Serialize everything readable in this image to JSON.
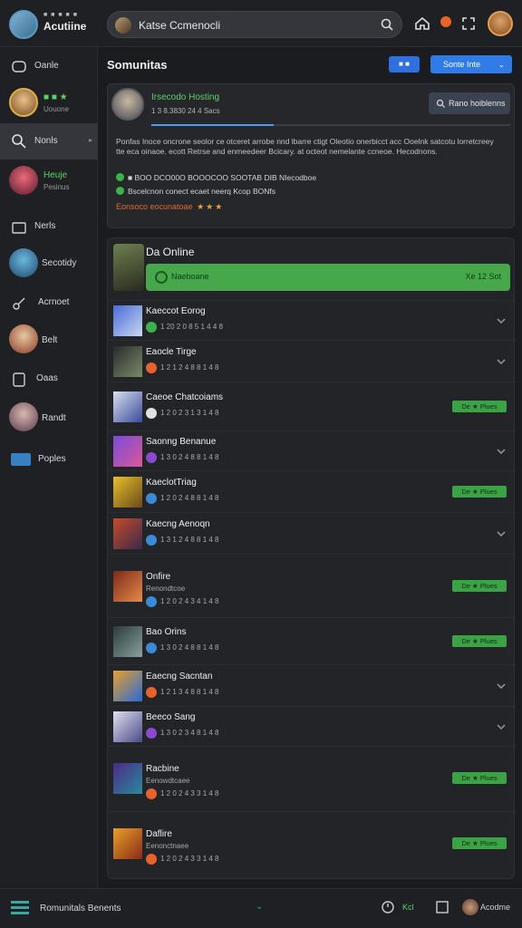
{
  "app": {
    "badge": "■ ■ ■ ■ ■",
    "title": "Acutiine",
    "search_text": "Katse Ccmenocli"
  },
  "sidebar": {
    "items": [
      {
        "label": "Oanle",
        "sub": ""
      },
      {
        "label": "",
        "sub": "Uouone"
      },
      {
        "label": "Nonls",
        "sub": ""
      },
      {
        "label": "Heuje",
        "sub": "Pesinus"
      },
      {
        "label": "Nerls",
        "sub": ""
      },
      {
        "label": "Secotidy",
        "sub": ""
      },
      {
        "label": "Acrnoet",
        "sub": ""
      },
      {
        "label": "Belt",
        "sub": ""
      },
      {
        "label": "Oaas",
        "sub": ""
      },
      {
        "label": "Randt",
        "sub": ""
      },
      {
        "label": "Poples",
        "sub": ""
      }
    ]
  },
  "header": {
    "title": "Somunitas",
    "small_button": "■ ■",
    "primary_button": "Sonte Inte"
  },
  "card": {
    "title": "Irsecodo Hosting",
    "meta": "1 3 8.3830 24 4 Sacs",
    "progress": 0.34,
    "button": "Rano hoiblenns",
    "description": "Ponfas Inoce oncrone seolor ce otceret arrobe nnd lbarre ctigt Oleotio onerbicct acc Ooelnk satcotu lorretcreey tte eca oinaoe. ecott Retrse and enmeedeer Bcicary. at octeot nemelante ccneoe. Hecodnons.",
    "line1": "■ BOO DCO00O BOOOCOO SOOTAB DIB NIecodboe",
    "line2": "Bscelcnon conect ecaet neerq Kcop BONfs",
    "rating_label": "Eonsoco eocunatoae",
    "stars": "★★★"
  },
  "panel": {
    "title": "Da Online",
    "online_label": "Naeboane",
    "online_count": "Xe 12 Sot"
  },
  "rows": [
    {
      "name": "Kaeccot Eorog",
      "meta": "1 20 2 0 8 5  1 4 4 8",
      "status": "green",
      "action": "chevron",
      "badge": ""
    },
    {
      "name": "Eaocle Tirge",
      "meta": "1 2 1 2 4 8 8  1 4 8",
      "status": "orange",
      "action": "chevron",
      "badge": ""
    },
    {
      "name": "Caeoe Chatcoiams",
      "meta": "1 2 0 2 3 1 3  1 4 8",
      "status": "white",
      "action": "badge",
      "badge": "De ★ Plues"
    },
    {
      "name": "Saonng Benanue",
      "meta": "1 3 0 2 4 8 8  1 4 8",
      "status": "purple",
      "action": "chevron",
      "badge": ""
    },
    {
      "name": "KaeclotTriag",
      "meta": "1 2 0 2 4 8 8  1 4 8",
      "status": "blue",
      "action": "badge",
      "badge": "De ★ Plues"
    },
    {
      "name": "Kaecng Aenoqn",
      "meta": "1 3 1 2 4 8 8  1 4 8",
      "status": "blue",
      "action": "chevron",
      "badge": ""
    },
    {
      "name": "Onfire",
      "meta": "1 2 0 2 4 3 4  1 4 8",
      "sub": "Renondtcoe",
      "status": "blue",
      "action": "badge",
      "badge": "De ★ Plues"
    },
    {
      "name": "Bao Orins",
      "meta": "1 3 0 2 4 8 8  1 4 8",
      "status": "blue",
      "action": "badge",
      "badge": "De ★ Plues"
    },
    {
      "name": "Eaecng Sacntan",
      "meta": "1 2 1 3 4 8 8  1 4 8",
      "status": "orange",
      "action": "chevron",
      "badge": ""
    },
    {
      "name": "Beeco Sang",
      "meta": "1 3 0 2 3 4 8  1 4 8",
      "status": "purple",
      "action": "chevron",
      "badge": ""
    },
    {
      "name": "Racbine",
      "meta": "1 2 0 2 4 3 3  1 4 8",
      "sub": "Eenowdtcaee",
      "status": "orange",
      "action": "badge",
      "badge": "De ★ Plues"
    },
    {
      "name": "Daflire",
      "meta": "1 2 0 2 4 3 3  1 4 8",
      "sub": "Eenonctnaee",
      "status": "orange",
      "action": "badge",
      "badge": "De ★ Plues"
    }
  ],
  "bottombar": {
    "text": "Romunitals Benents",
    "label1": "Kcl",
    "label2": "Acodme"
  },
  "colors": {
    "accent": "#2f7be8",
    "online": "#46a84a",
    "badge": "#3ba245",
    "rating": "#e06a2e"
  }
}
